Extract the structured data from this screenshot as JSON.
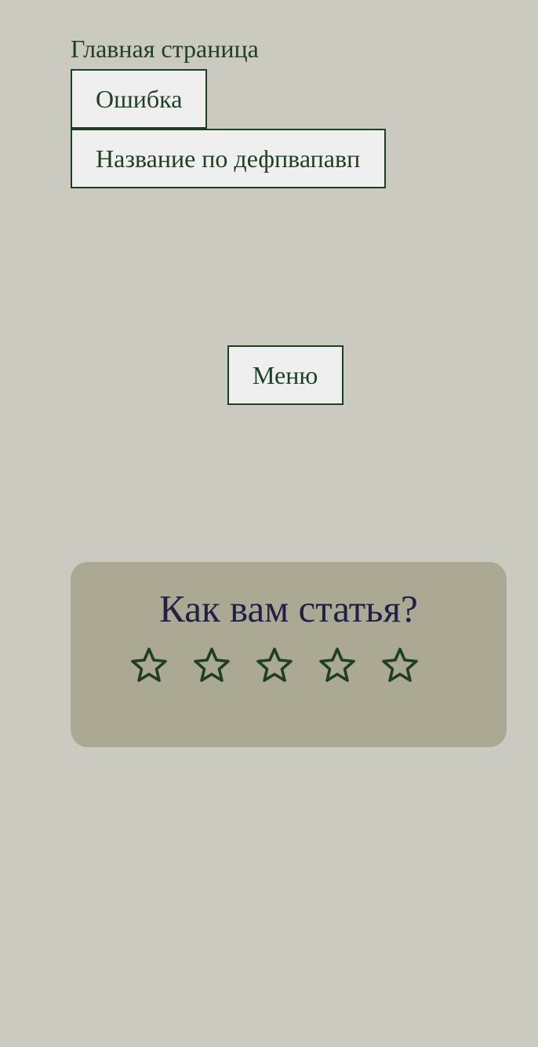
{
  "breadcrumb": {
    "label": "Главная страница"
  },
  "nav": {
    "error_label": "Ошибка",
    "title_label": "Название по дефпвапавп",
    "menu_label": "Меню"
  },
  "rating": {
    "question": "Как вам статья?",
    "max_stars": 5,
    "selected_stars": 0,
    "star_icon": "star-outline-icon"
  },
  "colors": {
    "background": "#cacac0",
    "accent": "#1f3f24",
    "button_bg": "#efefef",
    "card_bg": "#aba894",
    "question_text": "#212145"
  }
}
